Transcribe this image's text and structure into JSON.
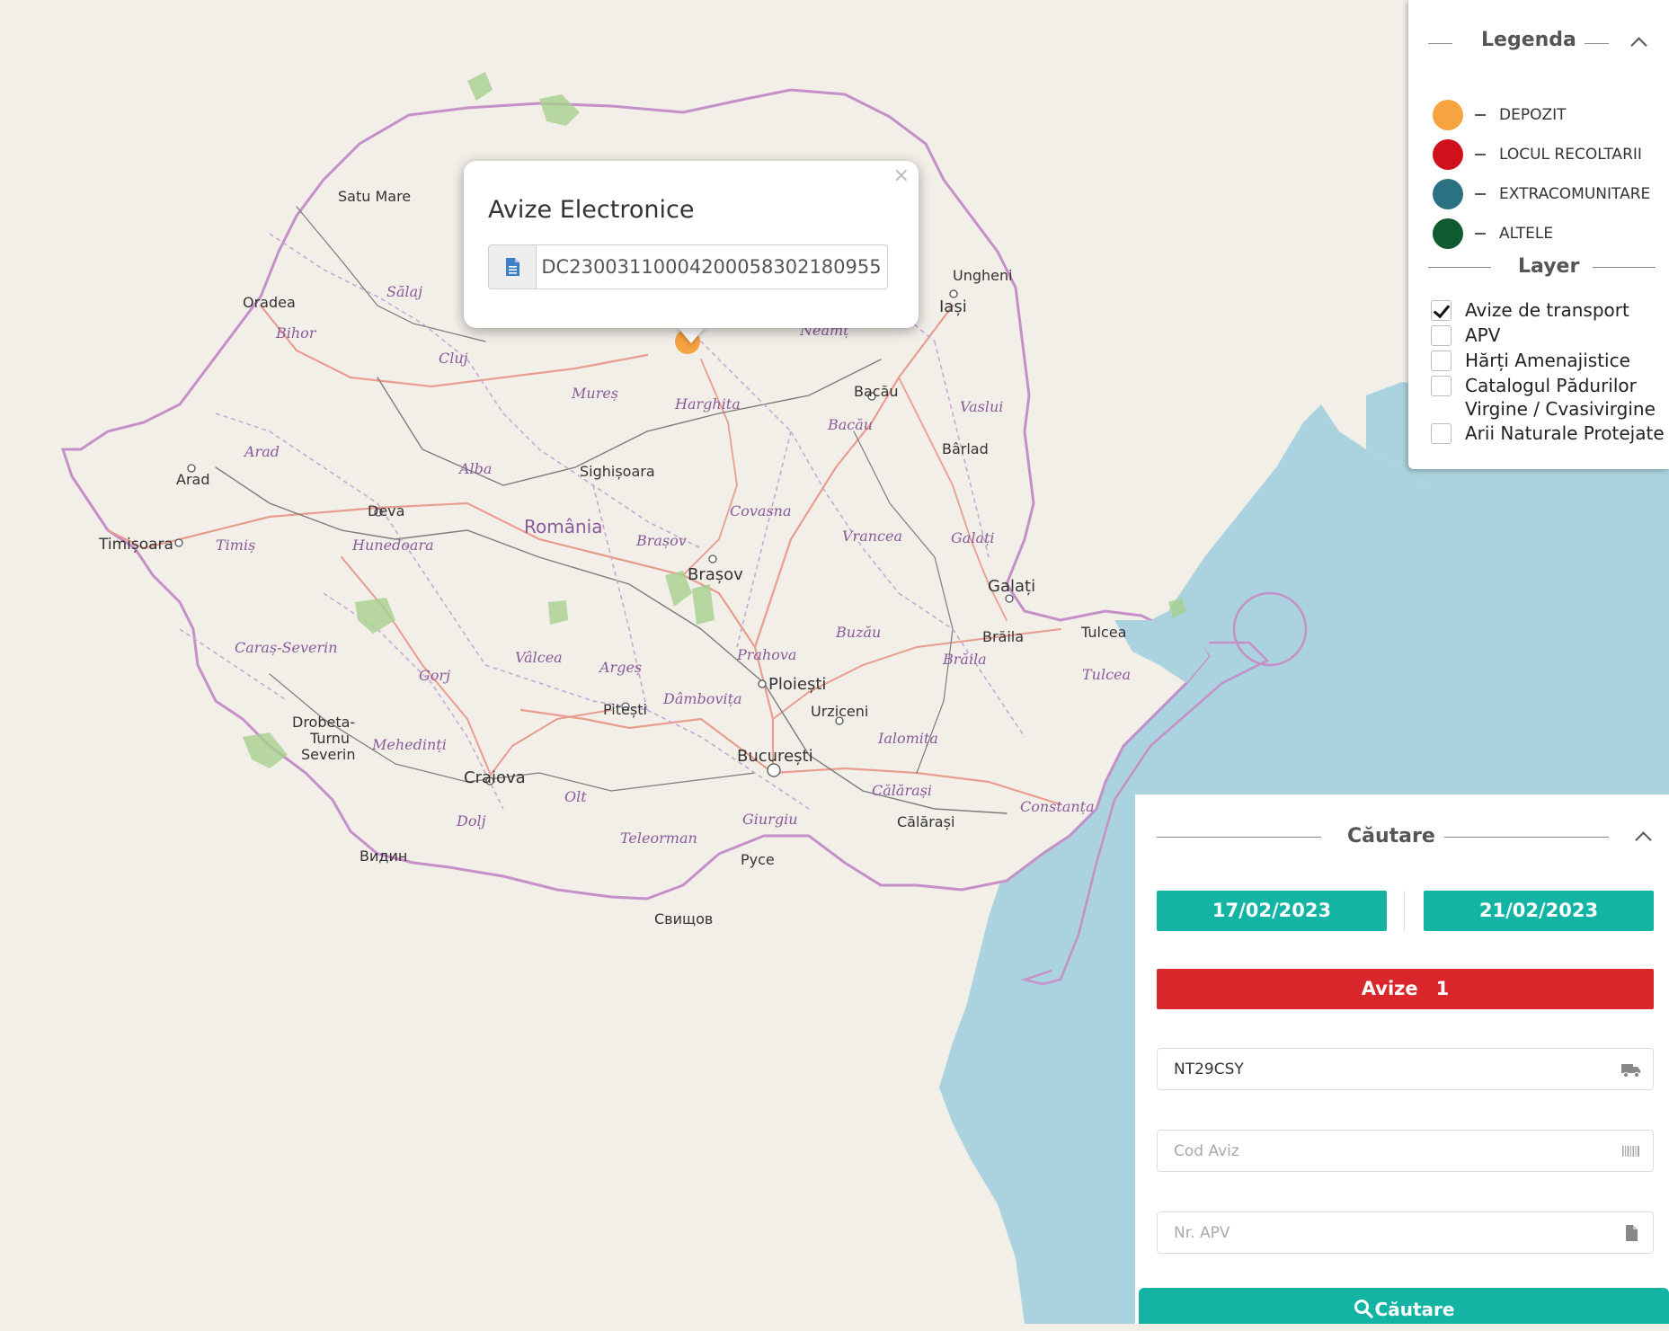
{
  "map": {
    "country_label": "România",
    "cities": [
      {
        "name": "Satu Mare"
      },
      {
        "name": "Oradea"
      },
      {
        "name": "Arad"
      },
      {
        "name": "Timișoara"
      },
      {
        "name": "Deva"
      },
      {
        "name": "Sighișoara"
      },
      {
        "name": "Brașov"
      },
      {
        "name": "Bacău"
      },
      {
        "name": "Iași"
      },
      {
        "name": "Ungheni"
      },
      {
        "name": "Bârlad"
      },
      {
        "name": "Galați"
      },
      {
        "name": "Brăila"
      },
      {
        "name": "Tulcea"
      },
      {
        "name": "Ploiești"
      },
      {
        "name": "Urziceni"
      },
      {
        "name": "București"
      },
      {
        "name": "Pitești"
      },
      {
        "name": "Craiova"
      },
      {
        "name": "Drobeta-"
      },
      {
        "name": "Turnu"
      },
      {
        "name": "Severin"
      },
      {
        "name": "Călărași"
      },
      {
        "name": "Видин"
      },
      {
        "name": "Русе"
      },
      {
        "name": "Свищов"
      }
    ],
    "counties": [
      {
        "name": "Sălaj"
      },
      {
        "name": "Bihor"
      },
      {
        "name": "Cluj"
      },
      {
        "name": "Mureș"
      },
      {
        "name": "Harghita"
      },
      {
        "name": "Neamț"
      },
      {
        "name": "Vaslui"
      },
      {
        "name": "Bacău"
      },
      {
        "name": "Arad"
      },
      {
        "name": "Alba"
      },
      {
        "name": "Timiș"
      },
      {
        "name": "Hunedoara"
      },
      {
        "name": "Covasna"
      },
      {
        "name": "Brașov"
      },
      {
        "name": "Vrancea"
      },
      {
        "name": "Galați"
      },
      {
        "name": "Caraș-Severin"
      },
      {
        "name": "Gorj"
      },
      {
        "name": "Vâlcea"
      },
      {
        "name": "Argeș"
      },
      {
        "name": "Prahova"
      },
      {
        "name": "Buzău"
      },
      {
        "name": "Brăila"
      },
      {
        "name": "Tulcea"
      },
      {
        "name": "Dâmbovița"
      },
      {
        "name": "Mehedinți"
      },
      {
        "name": "Ialomița"
      },
      {
        "name": "Olt"
      },
      {
        "name": "Dolj"
      },
      {
        "name": "Giurgiu"
      },
      {
        "name": "Călărași"
      },
      {
        "name": "Teleorman"
      },
      {
        "name": "Constanța"
      }
    ],
    "colors": {
      "land": "#f2efe9",
      "sea": "#aad3df",
      "border": "#c58fc8",
      "marker": "#f6a342"
    }
  },
  "popup": {
    "close": "×",
    "title": "Avize Electronice",
    "field_icon": "document-icon",
    "field_value": "DC230031100042000583021809​55"
  },
  "legend": {
    "title": "Legenda",
    "items": [
      {
        "label": "DEPOZIT",
        "color": "#f6a342"
      },
      {
        "label": "LOCUL RECOLTARII",
        "color": "#d0111b"
      },
      {
        "label": "EXTRACOMUNITARE",
        "color": "#2b7181"
      },
      {
        "label": "ALTELE",
        "color": "#0f5a2f"
      }
    ],
    "layer_title": "Layer",
    "layers": [
      {
        "label": "Avize de transport",
        "checked": true
      },
      {
        "label": "APV",
        "checked": false
      },
      {
        "label": "Hărți Amenajistice",
        "checked": false
      },
      {
        "label": "Catalogul Pădurilor",
        "label2": "Virgine / Cvasivirgine",
        "checked": false
      },
      {
        "label": "Arii Naturale Protejate",
        "checked": false
      }
    ]
  },
  "search": {
    "title": "Căutare",
    "date_from": "17/02/2023",
    "date_to": "21/02/2023",
    "avize_label": "Avize",
    "avize_count": "1",
    "plate_value": "NT29CSY",
    "cod_aviz_placeholder": "Cod Aviz",
    "nr_apv_placeholder": "Nr. APV",
    "button_label": "Căutare",
    "accent_color": "#14b4a4",
    "alert_color": "#d9262b"
  }
}
